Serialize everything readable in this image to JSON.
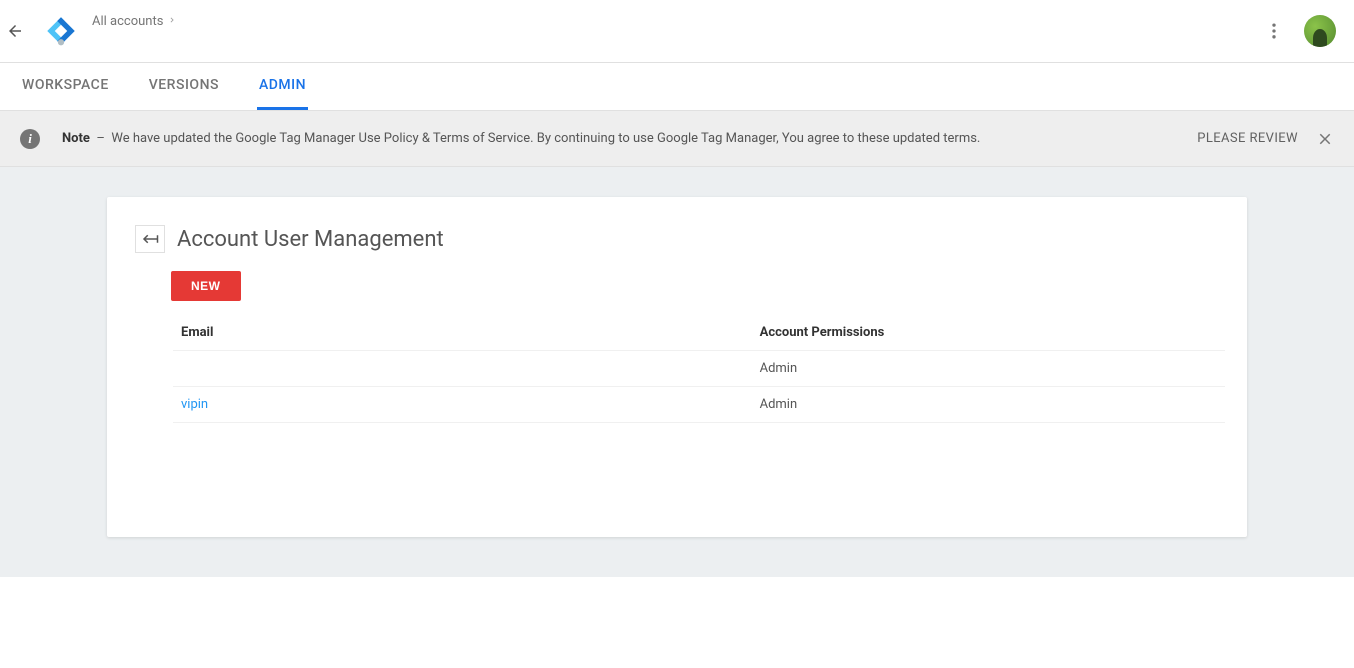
{
  "header": {
    "breadcrumb": "All accounts"
  },
  "tabs": [
    {
      "label": "WORKSPACE",
      "active": false
    },
    {
      "label": "VERSIONS",
      "active": false
    },
    {
      "label": "ADMIN",
      "active": true
    }
  ],
  "notice": {
    "label": "Note",
    "dash": "–",
    "text": "We have updated the Google Tag Manager Use Policy & Terms of Service. By continuing to use Google Tag Manager, You agree to these updated terms.",
    "review": "PLEASE REVIEW"
  },
  "page": {
    "title": "Account User Management",
    "new_button": "NEW"
  },
  "table": {
    "head_email": "Email",
    "head_perm": "Account Permissions",
    "rows": [
      {
        "email": "",
        "perm": "Admin"
      },
      {
        "email": "vipin",
        "perm": "Admin"
      }
    ]
  }
}
